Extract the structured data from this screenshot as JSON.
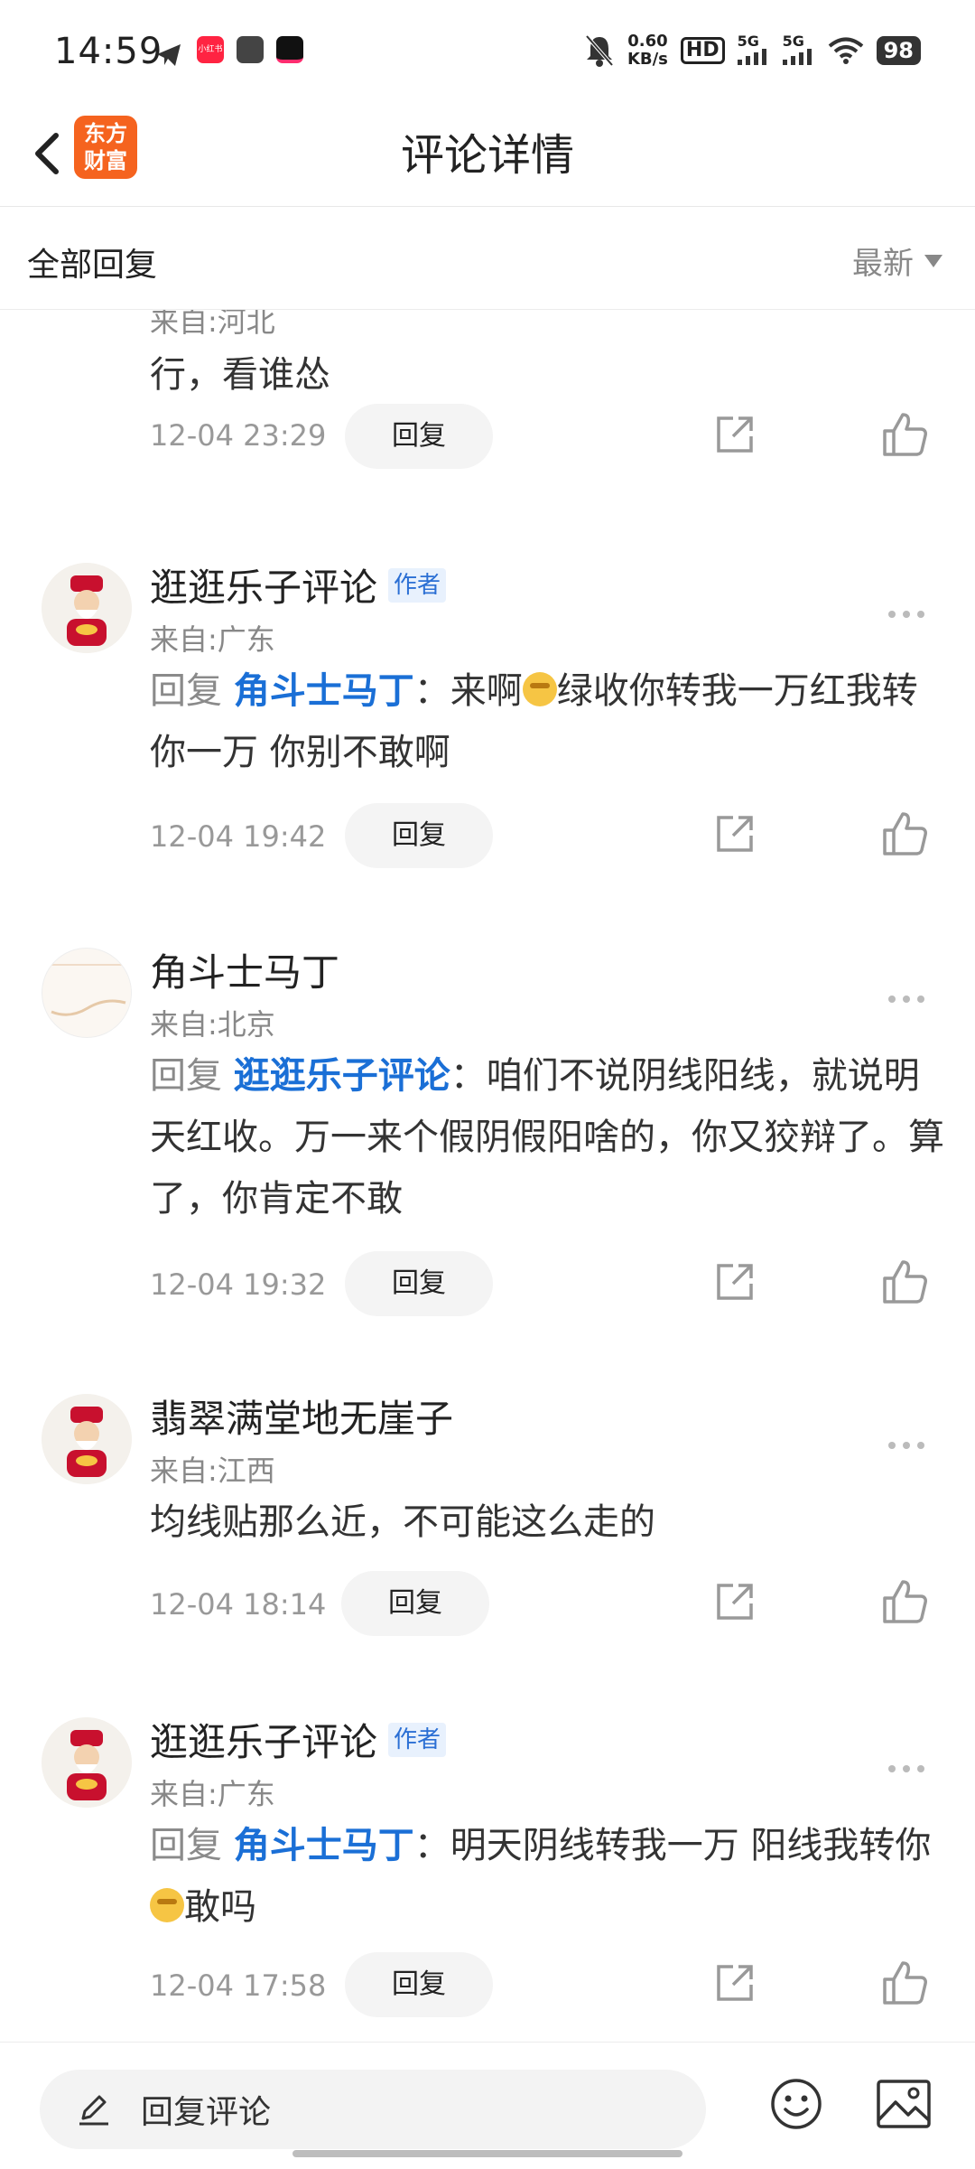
{
  "status": {
    "time": "14:59",
    "speed_value": "0.60",
    "speed_unit": "KB/s",
    "hd": "HD",
    "net1": "5G",
    "net2": "5G",
    "battery": "98",
    "app_icon_1": "小红书"
  },
  "header": {
    "title": "评论详情",
    "logo_line1": "东方",
    "logo_line2": "财富"
  },
  "subheader": {
    "all_label": "全部回复",
    "sort_label": "最新"
  },
  "comments": [
    {
      "location": "来自:河北",
      "text": "行，看谁怂",
      "time": "12-04 23:29",
      "reply_label": "回复"
    },
    {
      "name": "逛逛乐子评论",
      "author_tag": "作者",
      "location": "来自:广东",
      "reply_prefix": "回复",
      "mention": "角斗士马丁",
      "text_a": "：来啊",
      "text_b": "绿收你转我一万红我转你一万    你别不敢啊",
      "time": "12-04 19:42",
      "reply_label": "回复"
    },
    {
      "name": "角斗士马丁",
      "location": "来自:北京",
      "reply_prefix": "回复",
      "mention": "逛逛乐子评论",
      "text_a": "：咱们不说阴线阳线，就说明天红收。万一来个假阴假阳啥的，你又狡辩了。算了，你肯定不敢",
      "time": "12-04 19:32",
      "reply_label": "回复"
    },
    {
      "name": "翡翠满堂地无崖子",
      "location": "来自:江西",
      "text": "均线贴那么近，不可能这么走的",
      "time": "12-04 18:14",
      "reply_label": "回复"
    },
    {
      "name": "逛逛乐子评论",
      "author_tag": "作者",
      "location": "来自:广东",
      "reply_prefix": "回复",
      "mention": "角斗士马丁",
      "text_a": "：明天阴线转我一万 阳线我转你",
      "text_b": "敢吗",
      "time": "12-04 17:58",
      "reply_label": "回复"
    }
  ],
  "bottom": {
    "reply_placeholder": "回复评论"
  },
  "icons": {
    "back": "chevron-left-icon",
    "share": "share-icon",
    "like": "thumbs-up-icon",
    "more": "more-horizontal-icon",
    "edit": "pencil-icon",
    "emoji": "smile-icon",
    "image": "image-icon"
  },
  "colors": {
    "accent_blue": "#1a6fd6",
    "brand_orange": "#f5631f",
    "author_tag_bg": "#e8f1fd"
  }
}
